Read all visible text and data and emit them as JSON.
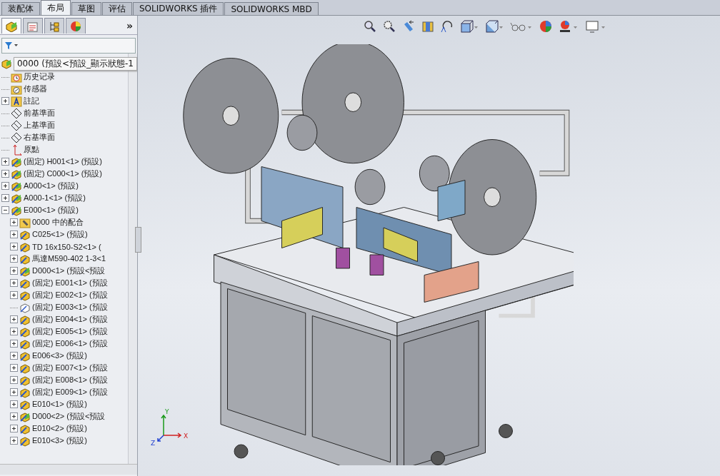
{
  "command_tabs": [
    {
      "label": "装配体",
      "selected": false
    },
    {
      "label": "布局",
      "selected": true
    },
    {
      "label": "草图",
      "selected": false
    },
    {
      "label": "评估",
      "selected": false
    },
    {
      "label": "SOLIDWORKS 插件",
      "selected": false
    },
    {
      "label": "SOLIDWORKS MBD",
      "selected": false
    }
  ],
  "panel_tabs": [
    {
      "kind": "feature-tree",
      "selected": true
    },
    {
      "kind": "property",
      "selected": false
    },
    {
      "kind": "config",
      "selected": false
    },
    {
      "kind": "display",
      "selected": false
    }
  ],
  "panel_more": "»",
  "tree": {
    "root": "0000  (預設<預設_顯示狀態-1",
    "items": [
      {
        "label": "历史记录",
        "kind": "history",
        "expandable": false
      },
      {
        "label": "传感器",
        "kind": "sensor",
        "expandable": false
      },
      {
        "label": "註記",
        "kind": "annotation",
        "expandable": true,
        "expanded": false
      },
      {
        "label": "前基準面",
        "kind": "plane",
        "expandable": false
      },
      {
        "label": "上基準面",
        "kind": "plane",
        "expandable": false
      },
      {
        "label": "右基準面",
        "kind": "plane",
        "expandable": false
      },
      {
        "label": "原點",
        "kind": "origin",
        "expandable": false
      },
      {
        "label": "(固定) H001<1> (預設)",
        "kind": "assembly",
        "expandable": true,
        "expanded": false
      },
      {
        "label": "(固定) C000<1> (預設)",
        "kind": "assembly",
        "expandable": true,
        "expanded": false
      },
      {
        "label": "A000<1> (預設)",
        "kind": "assembly",
        "expandable": true,
        "expanded": false
      },
      {
        "label": "A000-1<1> (預設)",
        "kind": "assembly",
        "expandable": true,
        "expanded": false
      },
      {
        "label": "E000<1> (預設)",
        "kind": "assembly",
        "expandable": true,
        "expanded": true,
        "children": [
          {
            "label": "0000 中的配合",
            "kind": "mates",
            "expandable": true,
            "expanded": false
          },
          {
            "label": "C025<1> (預設)",
            "kind": "part",
            "expandable": true,
            "expanded": false
          },
          {
            "label": "TD 16x150-S2<1> (",
            "kind": "part",
            "expandable": true,
            "expanded": false
          },
          {
            "label": "馬達M590-402 1-3<1",
            "kind": "part",
            "expandable": true,
            "expanded": false
          },
          {
            "label": "D000<1> (預設<預設",
            "kind": "assembly",
            "expandable": true,
            "expanded": false
          },
          {
            "label": "(固定) E001<1> (預設",
            "kind": "part",
            "expandable": true,
            "expanded": false
          },
          {
            "label": "(固定) E002<1> (預設",
            "kind": "part",
            "expandable": true,
            "expanded": false
          },
          {
            "label": "(固定) E003<1> (預設",
            "kind": "part-light",
            "expandable": false
          },
          {
            "label": "(固定) E004<1> (預設",
            "kind": "part",
            "expandable": true,
            "expanded": false
          },
          {
            "label": "(固定) E005<1> (預設",
            "kind": "part",
            "expandable": true,
            "expanded": false
          },
          {
            "label": "(固定) E006<1> (預設",
            "kind": "part",
            "expandable": true,
            "expanded": false
          },
          {
            "label": "E006<3> (預設)",
            "kind": "part",
            "expandable": true,
            "expanded": false
          },
          {
            "label": "(固定) E007<1> (預設",
            "kind": "part",
            "expandable": true,
            "expanded": false
          },
          {
            "label": "(固定) E008<1> (預設",
            "kind": "part",
            "expandable": true,
            "expanded": false
          },
          {
            "label": "(固定) E009<1> (預設",
            "kind": "part",
            "expandable": true,
            "expanded": false
          },
          {
            "label": "E010<1> (預設)",
            "kind": "part",
            "expandable": true,
            "expanded": false
          },
          {
            "label": "D000<2> (預設<預設",
            "kind": "assembly",
            "expandable": true,
            "expanded": false
          },
          {
            "label": "E010<2> (預設)",
            "kind": "part",
            "expandable": true,
            "expanded": false
          },
          {
            "label": "E010<3> (預設)",
            "kind": "part",
            "expandable": true,
            "expanded": false
          }
        ]
      }
    ]
  },
  "triad": {
    "x": "X",
    "y": "Y",
    "z": "Z"
  }
}
